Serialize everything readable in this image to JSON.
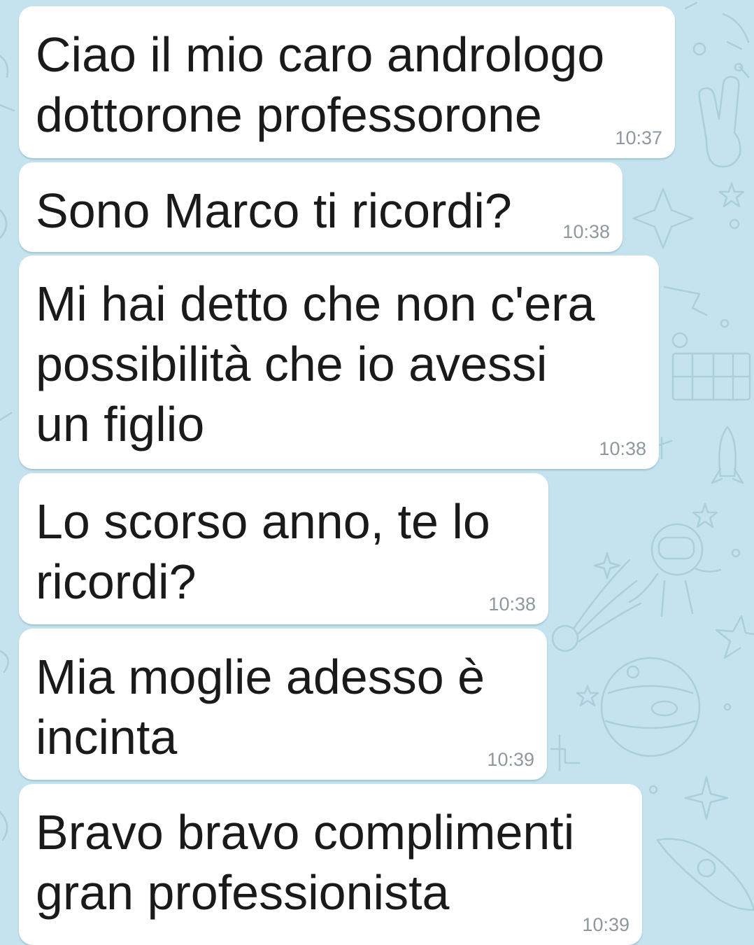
{
  "chat": {
    "messages": [
      {
        "text": "Ciao il mio caro andrologo\ndottorone professorone",
        "time": "10:37"
      },
      {
        "text": "Sono Marco ti ricordi?",
        "time": "10:38"
      },
      {
        "text": "Mi hai detto che non c'era\npossibilità che io avessi\nun figlio",
        "time": "10:38"
      },
      {
        "text": "Lo scorso anno, te lo\nricordi?",
        "time": "10:38"
      },
      {
        "text": "Mia moglie adesso è\nincinta",
        "time": "10:39"
      },
      {
        "text": "Bravo bravo complimenti\ngran professionista",
        "time": "10:39"
      }
    ]
  },
  "theme": {
    "background": "#c5e3ee",
    "bubble": "#ffffff",
    "doodle": "#a9cfdd",
    "time_color": "#8e989f"
  }
}
